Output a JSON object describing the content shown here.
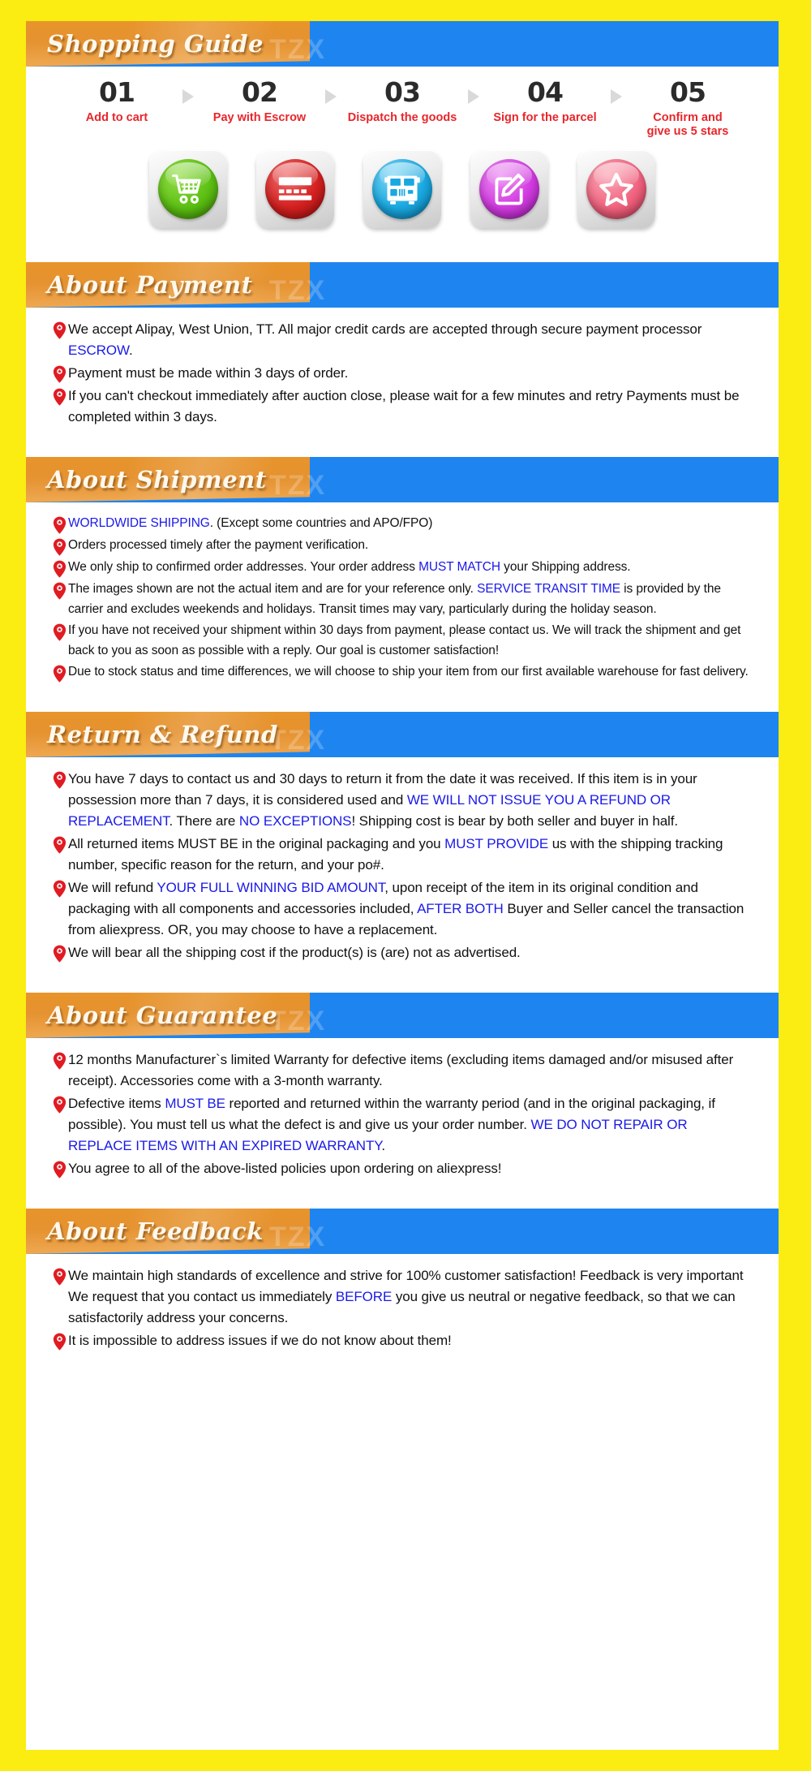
{
  "watermark": "TZX",
  "colors": {
    "page_background": "#FBEC12",
    "banner_orange": "#E8942B",
    "banner_blue": "#1E85F0",
    "highlight_blue": "#1A19E8",
    "step_label_red": "#E8262B",
    "pin_red": "#E01B22"
  },
  "shopping_guide": {
    "title": "Shopping Guide",
    "steps": [
      {
        "number": "01",
        "label": "Add to cart",
        "icon": "shopping-cart-icon",
        "color": "#5CBF12"
      },
      {
        "number": "02",
        "label": "Pay with Escrow",
        "icon": "credit-card-icon",
        "color": "#D42020"
      },
      {
        "number": "03",
        "label": "Dispatch the goods",
        "icon": "delivery-bus-icon",
        "color": "#19A8E0"
      },
      {
        "number": "04",
        "label": "Sign for the parcel",
        "icon": "sign-document-icon",
        "color": "#D13BE0"
      },
      {
        "number": "05",
        "label": "Confirm and\ngive us 5 stars",
        "icon": "star-icon",
        "color": "#F0637F"
      }
    ]
  },
  "about_payment": {
    "title": "About Payment",
    "items": [
      {
        "parts": [
          {
            "t": "We accept Alipay, West Union, TT. All major credit cards are accepted through secure payment processor ",
            "hl": false
          },
          {
            "t": "ESCROW",
            "hl": true
          },
          {
            "t": ".",
            "hl": false
          }
        ]
      },
      {
        "parts": [
          {
            "t": "Payment must be made within 3 days of order.",
            "hl": false
          }
        ]
      },
      {
        "parts": [
          {
            "t": "If you can't checkout immediately after auction close, please wait for a few minutes and retry Payments must be completed within 3 days.",
            "hl": false
          }
        ]
      }
    ]
  },
  "about_shipment": {
    "title": "About Shipment",
    "items": [
      {
        "parts": [
          {
            "t": "WORLDWIDE SHIPPING",
            "hl": true
          },
          {
            "t": ". (Except some countries and APO/FPO)",
            "hl": false
          }
        ]
      },
      {
        "parts": [
          {
            "t": "Orders processed timely after the payment verification.",
            "hl": false
          }
        ]
      },
      {
        "parts": [
          {
            "t": "We only ship to confirmed order addresses. Your order address ",
            "hl": false
          },
          {
            "t": "MUST MATCH",
            "hl": true
          },
          {
            "t": " your Shipping address.",
            "hl": false
          }
        ]
      },
      {
        "parts": [
          {
            "t": "The images shown are not the actual item and are for your reference only. ",
            "hl": false
          },
          {
            "t": "SERVICE TRANSIT TIME",
            "hl": true
          },
          {
            "t": " is provided by the carrier and excludes weekends and holidays. Transit times may vary, particularly during the holiday season.",
            "hl": false
          }
        ]
      },
      {
        "parts": [
          {
            "t": "If you have not received your shipment within 30 days from payment, please contact us. We will track the shipment and get back to you as soon as possible with a reply. Our goal is customer satisfaction!",
            "hl": false
          }
        ]
      },
      {
        "parts": [
          {
            "t": "Due to stock status and time differences, we will choose to ship your item from our first available warehouse for fast delivery.",
            "hl": false
          }
        ]
      }
    ]
  },
  "return_refund": {
    "title": "Return & Refund",
    "items": [
      {
        "parts": [
          {
            "t": "You have 7 days to contact us and 30 days to return it from the date it was received. If this item is in your possession more than 7 days, it is considered used and ",
            "hl": false
          },
          {
            "t": "WE WILL NOT ISSUE YOU A REFUND OR REPLACEMENT",
            "hl": true
          },
          {
            "t": ". There are ",
            "hl": false
          },
          {
            "t": "NO EXCEPTIONS",
            "hl": true
          },
          {
            "t": "! Shipping cost is bear by both seller and buyer in half.",
            "hl": false
          }
        ]
      },
      {
        "parts": [
          {
            "t": "All returned items MUST BE in the original packaging and you ",
            "hl": false
          },
          {
            "t": "MUST PROVIDE",
            "hl": true
          },
          {
            "t": " us with the shipping tracking number, specific reason for the return, and your po#.",
            "hl": false
          }
        ]
      },
      {
        "parts": [
          {
            "t": "We will refund ",
            "hl": false
          },
          {
            "t": "YOUR FULL WINNING BID AMOUNT",
            "hl": true
          },
          {
            "t": ", upon receipt of the item in its original condition and packaging with all components and accessories included, ",
            "hl": false
          },
          {
            "t": "AFTER BOTH",
            "hl": true
          },
          {
            "t": " Buyer and Seller cancel the transaction from aliexpress. OR, you may choose to have a replacement.",
            "hl": false
          }
        ]
      },
      {
        "parts": [
          {
            "t": "We will bear all the shipping cost if the product(s) is (are) not as advertised.",
            "hl": false
          }
        ]
      }
    ]
  },
  "about_guarantee": {
    "title": "About Guarantee",
    "items": [
      {
        "parts": [
          {
            "t": "12 months Manufacturer`s limited Warranty for defective items (excluding items damaged and/or misused after receipt). Accessories come with a 3-month warranty.",
            "hl": false
          }
        ]
      },
      {
        "parts": [
          {
            "t": "Defective items ",
            "hl": false
          },
          {
            "t": "MUST BE",
            "hl": true
          },
          {
            "t": " reported and returned within the warranty period (and in the original packaging, if possible). You must tell us what the defect is and give us your order number. ",
            "hl": false
          },
          {
            "t": "WE DO NOT REPAIR OR REPLACE ITEMS WITH AN EXPIRED WARRANTY",
            "hl": true
          },
          {
            "t": ".",
            "hl": false
          }
        ]
      },
      {
        "parts": [
          {
            "t": "You agree to all of the above-listed policies upon ordering on aliexpress!",
            "hl": false
          }
        ]
      }
    ]
  },
  "about_feedback": {
    "title": "About Feedback",
    "items": [
      {
        "parts": [
          {
            "t": "We maintain high standards of excellence and strive for 100% customer satisfaction! Feedback is very important We request that you contact us immediately ",
            "hl": false
          },
          {
            "t": "BEFORE",
            "hl": true
          },
          {
            "t": " you give us neutral or negative feedback, so that we can satisfactorily address your concerns.",
            "hl": false
          }
        ]
      },
      {
        "parts": [
          {
            "t": "It is impossible to address issues if we do not know about them!",
            "hl": false
          }
        ]
      }
    ]
  }
}
